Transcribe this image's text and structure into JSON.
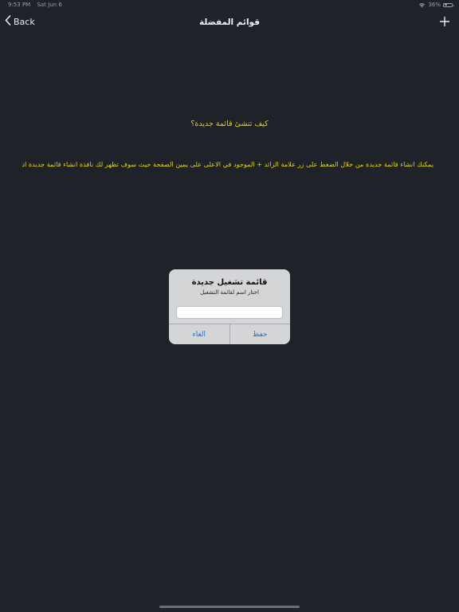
{
  "status_bar": {
    "time": "9:53 PM",
    "date": "Sat Jun 6",
    "battery": "36%",
    "battery_level": 0.36
  },
  "nav": {
    "back_label": "Back",
    "title": "قوائم المفضلة",
    "back_icon": "chevron-left-icon",
    "add_icon": "plus-icon"
  },
  "help": {
    "title": "كيف تنشئ قائمة جديدة؟",
    "body": "يمكنك انشاء قائمة جديدة من خلال الضغط على زر علامة الزائد + الموجود في الاعلى على يمين الصفحة حيث سوف تظهر لك نافذة انشاء قائمة جديدة ادخل فيها اسم القائمة واضغط على زر حفظ"
  },
  "alert": {
    "title": "قائمة تشغيل جديدة",
    "message": "اختار اسم لقائمة التشغيل",
    "input_value": "",
    "cancel_label": "الغاء",
    "save_label": "حفظ"
  },
  "colors": {
    "background": "#1f2329",
    "help_text": "#e5d51a",
    "alert_bg": "#d4d5d7",
    "alert_button": "#1d6fd6"
  }
}
